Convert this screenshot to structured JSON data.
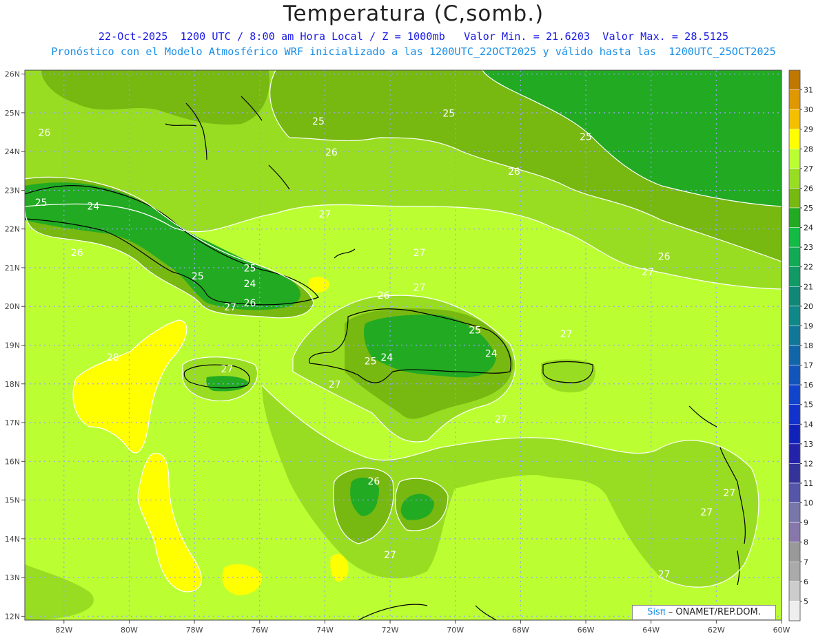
{
  "title": "Temperatura (C,somb.)",
  "subtitle_line1": "22-Oct-2025  1200 UTC / 8:00 am Hora Local / Z = 1000mb   Valor Min. = 21.6203  Valor Max. = 28.5125",
  "subtitle_line2": "Pronóstico con el Modelo Atmosférico WRF inicializado a las 1200UTC_22OCT2025 y válido hasta las  1200UTC_25OCT2025",
  "credit": {
    "brand": "Sisπ",
    "text": " – ONAMET/REP.DOM."
  },
  "map": {
    "lon_range": [
      -83.2,
      -60
    ],
    "lat_range": [
      11.9,
      26.1
    ],
    "lon_ticks": [
      -82,
      -80,
      -78,
      -76,
      -74,
      -72,
      -70,
      -68,
      -66,
      -64,
      -62,
      -60
    ],
    "lon_tick_labels": [
      "82W",
      "80W",
      "78W",
      "76W",
      "74W",
      "72W",
      "70W",
      "68W",
      "66W",
      "64W",
      "62W",
      "60W"
    ],
    "lat_ticks": [
      26,
      25,
      24,
      23,
      22,
      21,
      20,
      19,
      18,
      17,
      16,
      15,
      14,
      13,
      12
    ],
    "lat_tick_labels": [
      "26N",
      "25N",
      "24N",
      "23N",
      "22N",
      "21N",
      "20N",
      "19N",
      "18N",
      "17N",
      "16N",
      "15N",
      "14N",
      "13N",
      "12N"
    ],
    "grid": true,
    "contour_labels": [
      {
        "text": "26",
        "lon": -82.6,
        "lat": 24.4
      },
      {
        "text": "25",
        "lon": -74.2,
        "lat": 24.7
      },
      {
        "text": "25",
        "lon": -70.2,
        "lat": 24.9
      },
      {
        "text": "26",
        "lon": -73.8,
        "lat": 23.9
      },
      {
        "text": "25",
        "lon": -66.0,
        "lat": 24.3
      },
      {
        "text": "26",
        "lon": -68.2,
        "lat": 23.4
      },
      {
        "text": "25",
        "lon": -82.7,
        "lat": 22.6
      },
      {
        "text": "24",
        "lon": -81.1,
        "lat": 22.5
      },
      {
        "text": "27",
        "lon": -74.0,
        "lat": 22.3
      },
      {
        "text": "26",
        "lon": -81.6,
        "lat": 21.3
      },
      {
        "text": "27",
        "lon": -71.1,
        "lat": 21.3
      },
      {
        "text": "26",
        "lon": -63.6,
        "lat": 21.2
      },
      {
        "text": "25",
        "lon": -76.3,
        "lat": 20.9
      },
      {
        "text": "27",
        "lon": -64.1,
        "lat": 20.8
      },
      {
        "text": "25",
        "lon": -77.9,
        "lat": 20.7
      },
      {
        "text": "24",
        "lon": -76.3,
        "lat": 20.5
      },
      {
        "text": "27",
        "lon": -71.1,
        "lat": 20.4
      },
      {
        "text": "26",
        "lon": -72.2,
        "lat": 20.2
      },
      {
        "text": "27",
        "lon": -76.9,
        "lat": 19.9
      },
      {
        "text": "26",
        "lon": -76.3,
        "lat": 20.0
      },
      {
        "text": "25",
        "lon": -69.4,
        "lat": 19.3
      },
      {
        "text": "27",
        "lon": -66.6,
        "lat": 19.2
      },
      {
        "text": "28",
        "lon": -80.5,
        "lat": 18.6
      },
      {
        "text": "24",
        "lon": -68.9,
        "lat": 18.7
      },
      {
        "text": "25",
        "lon": -72.6,
        "lat": 18.5
      },
      {
        "text": "24",
        "lon": -72.1,
        "lat": 18.6
      },
      {
        "text": "27",
        "lon": -77.0,
        "lat": 18.3
      },
      {
        "text": "27",
        "lon": -73.7,
        "lat": 17.9
      },
      {
        "text": "27",
        "lon": -68.6,
        "lat": 17.0
      },
      {
        "text": "26",
        "lon": -72.5,
        "lat": 15.4
      },
      {
        "text": "27",
        "lon": -61.6,
        "lat": 15.1
      },
      {
        "text": "27",
        "lon": -62.3,
        "lat": 14.6
      },
      {
        "text": "27",
        "lon": -72.0,
        "lat": 13.5
      },
      {
        "text": "27",
        "lon": -63.6,
        "lat": 13.0
      }
    ]
  },
  "colorbar": {
    "labels": [
      "31",
      "30",
      "29",
      "28",
      "27",
      "26",
      "25",
      "24",
      "23",
      "22",
      "21",
      "20",
      "19",
      "18",
      "17",
      "16",
      "15",
      "14",
      "13",
      "12",
      "11",
      "10",
      "9",
      "8",
      "7",
      "6",
      "5"
    ],
    "colors": [
      "#c07800",
      "#e09800",
      "#f4c000",
      "#ffff00",
      "#bbff33",
      "#99dd22",
      "#77b811",
      "#22aa22",
      "#11bb44",
      "#11aa55",
      "#119966",
      "#118877",
      "#118888",
      "#117799",
      "#1166aa",
      "#1155bb",
      "#1144cc",
      "#1133cc",
      "#1122bb",
      "#2222aa",
      "#333399",
      "#5555aa",
      "#7777aa",
      "#8877aa",
      "#999999",
      "#aaaaaa",
      "#cccccc",
      "#eeeeee"
    ]
  },
  "temperature_colors": {
    "24": "#22aa22",
    "25": "#77b811",
    "26": "#99dd22",
    "27": "#bbff33",
    "28": "#ffff00"
  }
}
